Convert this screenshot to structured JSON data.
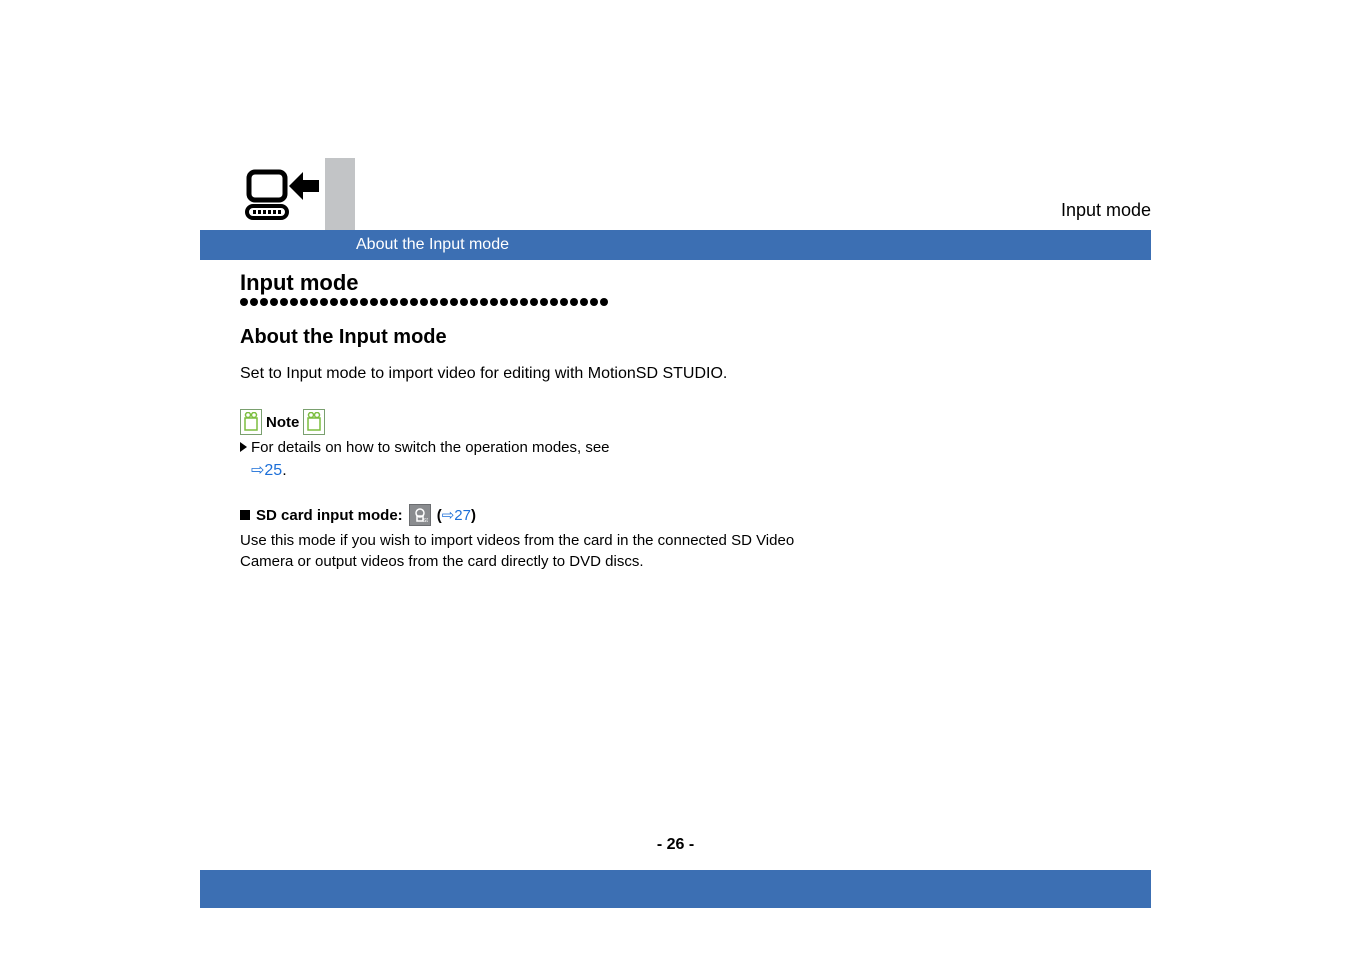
{
  "header": {
    "right_text": "Input mode",
    "bar_text": "About the Input mode"
  },
  "content": {
    "section_title": "Input mode",
    "sub_title": "About the Input mode",
    "body_text": "Set to Input mode to import video for editing with MotionSD STUDIO.",
    "note": {
      "label": "Note",
      "detail": "For details on how to switch the operation modes, see",
      "link": "⇨25",
      "period": "."
    },
    "sd": {
      "heading": "SD card input mode:",
      "link_open": "(",
      "link": "⇨27",
      "link_close": ")",
      "body": "Use this mode if you wish to import videos from the card in the connected SD Video Camera or output videos from the card directly to DVD discs."
    }
  },
  "footer": {
    "page_number": "- 26 -"
  },
  "icons": {
    "logo": "monitor-transfer-icon",
    "note_clip": "clip-note-icon",
    "sd_card": "sd-card-icon"
  }
}
